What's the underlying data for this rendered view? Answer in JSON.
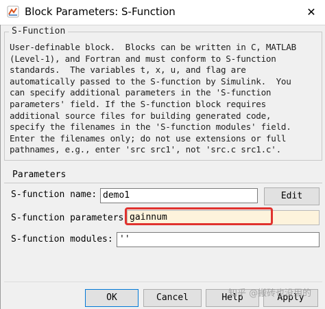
{
  "window": {
    "title": "Block Parameters: S-Function",
    "close_glyph": "✕",
    "watermark": "知乎 @搬砖也没用的"
  },
  "sfunction_group": {
    "legend": "S-Function",
    "description_lines": [
      "User-definable block.  Blocks can be written in C, MATLAB",
      "(Level-1), and Fortran and must conform to S-function",
      "standards.  The variables t, x, u, and flag are",
      "automatically passed to the S-function by Simulink.  You",
      "can specify additional parameters in the 'S-function",
      "parameters' field. If the S-function block requires",
      "additional source files for building generated code,",
      "specify the filenames in the 'S-function modules' field.",
      "Enter the filenames only; do not use extensions or full",
      "pathnames, e.g., enter 'src src1', not 'src.c src1.c'."
    ]
  },
  "parameters": {
    "title": "Parameters",
    "name_label": "S-function name:",
    "name_value": "demo1",
    "edit_label": "Edit",
    "params_label": "S-function parameters",
    "params_value": "gainnum",
    "modules_label": "S-function modules:",
    "modules_value": "''"
  },
  "buttons": {
    "ok": "OK",
    "cancel": "Cancel",
    "help": "Help",
    "apply": "Apply"
  },
  "colors": {
    "highlight": "#e0322e",
    "field_active_bg": "#fdf3dc"
  }
}
